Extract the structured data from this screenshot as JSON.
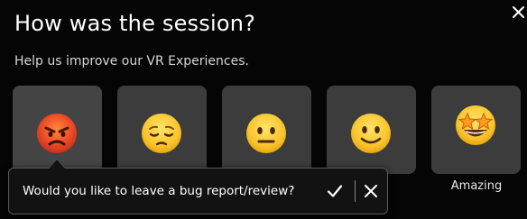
{
  "dialog": {
    "title": "How was the session?",
    "subtitle": "Help us improve our VR Experiences.",
    "close_icon": "close-icon"
  },
  "ratings": {
    "options": [
      {
        "icon": "angry-face-icon",
        "label": "",
        "selected": true
      },
      {
        "icon": "pensive-face-icon",
        "label": ""
      },
      {
        "icon": "neutral-face-icon",
        "label": ""
      },
      {
        "icon": "slightly-smiling-face-icon",
        "label": ""
      },
      {
        "icon": "star-struck-face-icon",
        "label": "Amazing"
      }
    ]
  },
  "toast": {
    "message": "Would you like to leave a bug report/review?",
    "confirm_icon": "check-icon",
    "dismiss_icon": "close-icon"
  },
  "colors": {
    "background": "#050505",
    "tile": "#3c3c3c",
    "toast_border": "#5a5a5a"
  }
}
